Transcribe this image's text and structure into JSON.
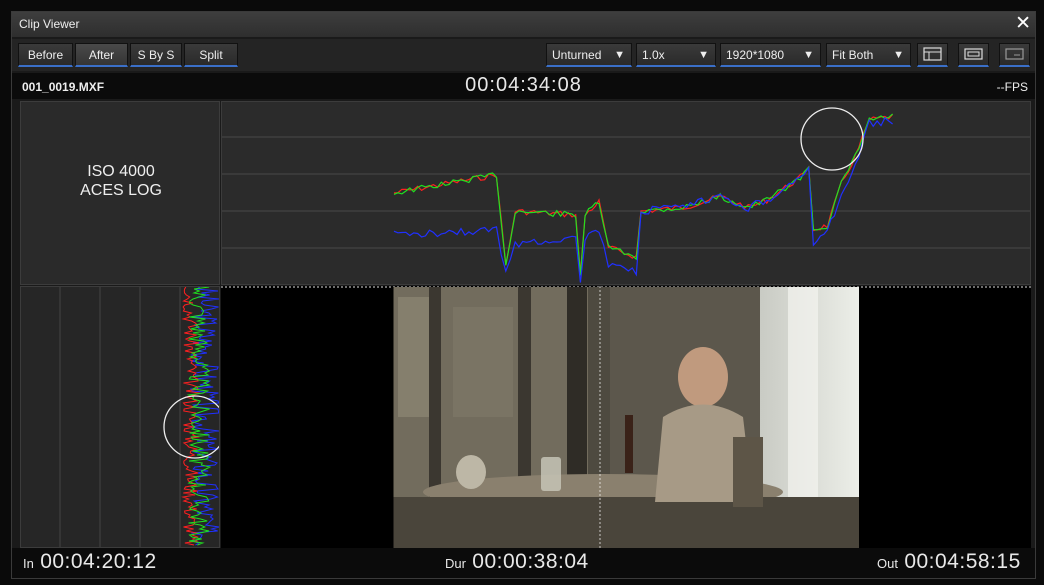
{
  "window": {
    "title": "Clip Viewer",
    "close_glyph": "✕"
  },
  "toolbar": {
    "buttons": [
      "Before",
      "After",
      "S By S",
      "Split"
    ],
    "dropdowns": [
      {
        "value": "Unturned"
      },
      {
        "value": "1.0x"
      },
      {
        "value": "1920*1080"
      },
      {
        "value": "Fit Both"
      }
    ],
    "view_icons": [
      "layout-waveform-icon",
      "layout-frame-icon",
      "layout-compact-icon"
    ]
  },
  "info": {
    "filename": "001_0019.MXF",
    "timecode": "00:04:34:08",
    "fps": "--FPS"
  },
  "metadata": {
    "line1": "ISO 4000",
    "line2": "ACES LOG"
  },
  "timecodes": {
    "in_label": "In",
    "in_value": "00:04:20:12",
    "dur_label": "Dur",
    "dur_value": "00:00:38:04",
    "out_label": "Out",
    "out_value": "00:04:58:15"
  },
  "colors": {
    "accent": "#3a6fc8",
    "red": "#ff2020",
    "green": "#20e020",
    "blue": "#2030ff"
  },
  "waveform_h_levels": {
    "green": [
      [
        0,
        0.5
      ],
      [
        0.22,
        0.4
      ],
      [
        0.24,
        0.9
      ],
      [
        0.26,
        0.6
      ],
      [
        0.39,
        0.62
      ],
      [
        0.4,
        0.95
      ],
      [
        0.41,
        0.62
      ],
      [
        0.44,
        0.55
      ],
      [
        0.46,
        0.8
      ],
      [
        0.52,
        0.85
      ],
      [
        0.53,
        0.6
      ],
      [
        0.62,
        0.58
      ],
      [
        0.66,
        0.55
      ],
      [
        0.7,
        0.52
      ],
      [
        0.76,
        0.58
      ],
      [
        0.8,
        0.54
      ],
      [
        0.88,
        0.4
      ],
      [
        0.89,
        0.35
      ],
      [
        0.9,
        0.7
      ],
      [
        0.93,
        0.68
      ],
      [
        0.96,
        0.45
      ],
      [
        0.99,
        0.3
      ],
      [
        1.02,
        0.1
      ],
      [
        1.07,
        0.08
      ],
      [
        1.08,
        0.3
      ]
    ],
    "blue": [
      [
        0,
        0.73
      ],
      [
        0.22,
        0.7
      ],
      [
        0.24,
        0.95
      ],
      [
        0.26,
        0.78
      ],
      [
        0.39,
        0.74
      ],
      [
        0.4,
        0.98
      ],
      [
        0.41,
        0.75
      ],
      [
        0.44,
        0.7
      ],
      [
        0.46,
        0.9
      ],
      [
        0.52,
        0.94
      ],
      [
        0.53,
        0.6
      ],
      [
        0.62,
        0.58
      ],
      [
        0.66,
        0.55
      ],
      [
        0.7,
        0.52
      ],
      [
        0.76,
        0.58
      ],
      [
        0.8,
        0.54
      ],
      [
        0.88,
        0.4
      ],
      [
        0.89,
        0.35
      ],
      [
        0.9,
        0.78
      ],
      [
        0.93,
        0.72
      ],
      [
        0.96,
        0.5
      ],
      [
        0.99,
        0.35
      ],
      [
        1.02,
        0.12
      ],
      [
        1.07,
        0.1
      ],
      [
        1.08,
        0.32
      ]
    ]
  }
}
